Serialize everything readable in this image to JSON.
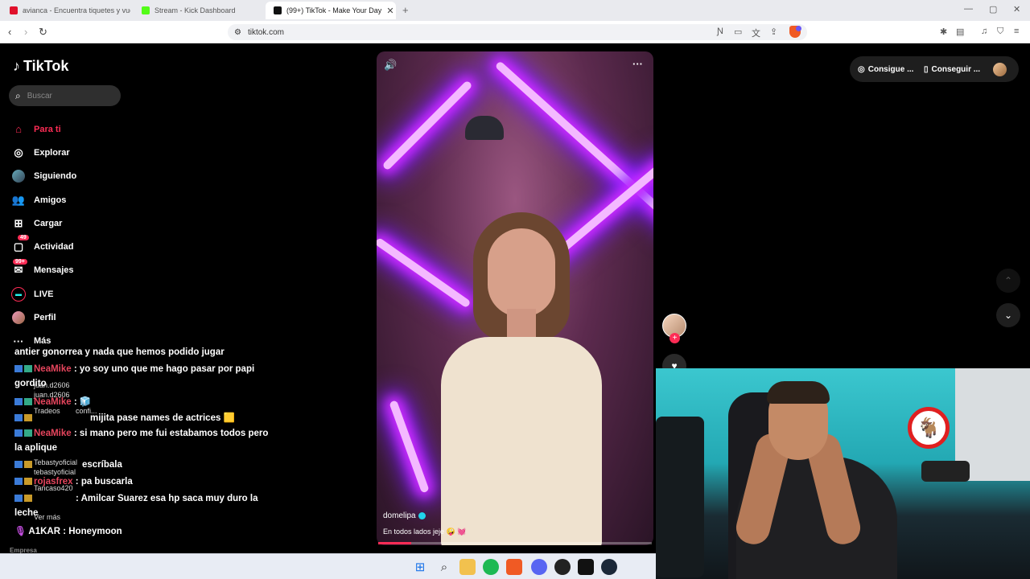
{
  "browser": {
    "tabs": [
      {
        "title": "avianca - Encuentra tiquetes y vuelos",
        "color": "#e0112b"
      },
      {
        "title": "Stream - Kick Dashboard",
        "color": "#53fc18"
      },
      {
        "title": "(99+) TikTok - Make Your Day",
        "color": "#111111"
      }
    ],
    "url": "tiktok.com"
  },
  "tiktok": {
    "logo": "TikTok",
    "search_placeholder": "Buscar",
    "nav": [
      {
        "label": "Para ti",
        "icon": "home-icon",
        "active": true
      },
      {
        "label": "Explorar",
        "icon": "compass-icon"
      },
      {
        "label": "Siguiendo",
        "icon": "avatar"
      },
      {
        "label": "Amigos",
        "icon": "people-icon"
      },
      {
        "label": "Cargar",
        "icon": "plus-square-icon"
      },
      {
        "label": "Actividad",
        "icon": "inbox-icon",
        "badge": "49"
      },
      {
        "label": "Mensajes",
        "icon": "message-icon",
        "badge": "99+"
      },
      {
        "label": "LIVE",
        "icon": "live-icon"
      },
      {
        "label": "Perfil",
        "icon": "avatar"
      },
      {
        "label": "Más",
        "icon": "more-icon"
      }
    ],
    "empresa": "Empresa",
    "video": {
      "author": "domelipa",
      "description": "En todos lados jeje 🤪 💓"
    },
    "header_buttons": [
      "Consigue ...",
      "Conseguir ..."
    ]
  },
  "chat": {
    "lines": [
      {
        "user": "",
        "text": "antier gonorrea y nada que hemos podido jugar"
      },
      {
        "user": "NeaMike",
        "text": ": yo soy uno que me hago pasar por papi"
      },
      {
        "user": "",
        "text": "gordito"
      },
      {
        "user": "NeaMike",
        "text": ": 🧊"
      },
      {
        "user": "",
        "text": "mijita pase names de actrices 🟨"
      },
      {
        "user": "NeaMike",
        "text": ": si mano pero me fui estabamos todos pero"
      },
      {
        "user": "",
        "text": "la aplique"
      },
      {
        "user": "",
        "text": "escríbala"
      },
      {
        "user": "rojasfrex",
        "text": ": pa buscarla"
      },
      {
        "user": "",
        "text": ": Amilcar Suarez esa hp saca muy duro la"
      },
      {
        "user": "",
        "text": "leche"
      },
      {
        "user": "A1KAR",
        "text": ": Honeymoon"
      }
    ],
    "ghost": [
      "juan.d2606",
      "juan.d2606",
      "Tradeos",
      "confi...",
      "Tebastyoficial",
      "tebastyoficial",
      "Tancaso420",
      "Ver más"
    ]
  }
}
